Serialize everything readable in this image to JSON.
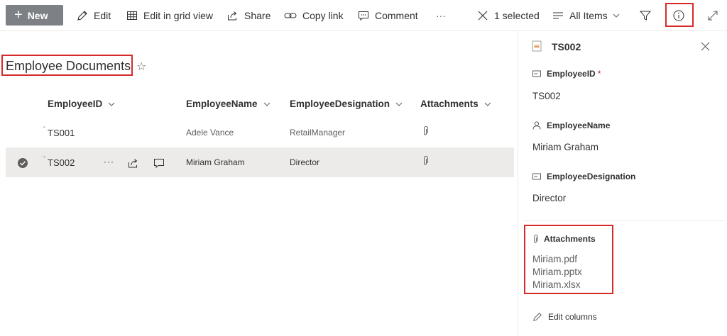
{
  "toolbar": {
    "new_label": "New",
    "edit_label": "Edit",
    "grid_label": "Edit in grid view",
    "share_label": "Share",
    "copy_link_label": "Copy link",
    "comment_label": "Comment",
    "more_label": "···",
    "selected_label": "1 selected",
    "view_label": "All Items"
  },
  "list": {
    "title": "Employee Documents",
    "columns": [
      "EmployeeID",
      "EmployeeName",
      "EmployeeDesignation",
      "Attachments"
    ],
    "rows": [
      {
        "id": "TS001",
        "name": "Adele Vance",
        "designation": "RetailManager",
        "selected": false
      },
      {
        "id": "TS002",
        "name": "Miriam Graham",
        "designation": "Director",
        "selected": true
      }
    ]
  },
  "details": {
    "title": "TS002",
    "fields": [
      {
        "label": "EmployeeID",
        "required_mark": "*",
        "value": "TS002"
      },
      {
        "label": "EmployeeName",
        "value": "Miriam Graham"
      },
      {
        "label": "EmployeeDesignation",
        "value": "Director"
      }
    ],
    "attachments_label": "Attachments",
    "attachments": [
      "Miriam.pdf",
      "Miriam.pptx",
      "Miriam.xlsx"
    ],
    "edit_columns_label": "Edit columns"
  },
  "colors": {
    "new_button_bg": "#7d8186",
    "highlight": "#d62a2a",
    "selected_row_bg": "#edebe9"
  }
}
